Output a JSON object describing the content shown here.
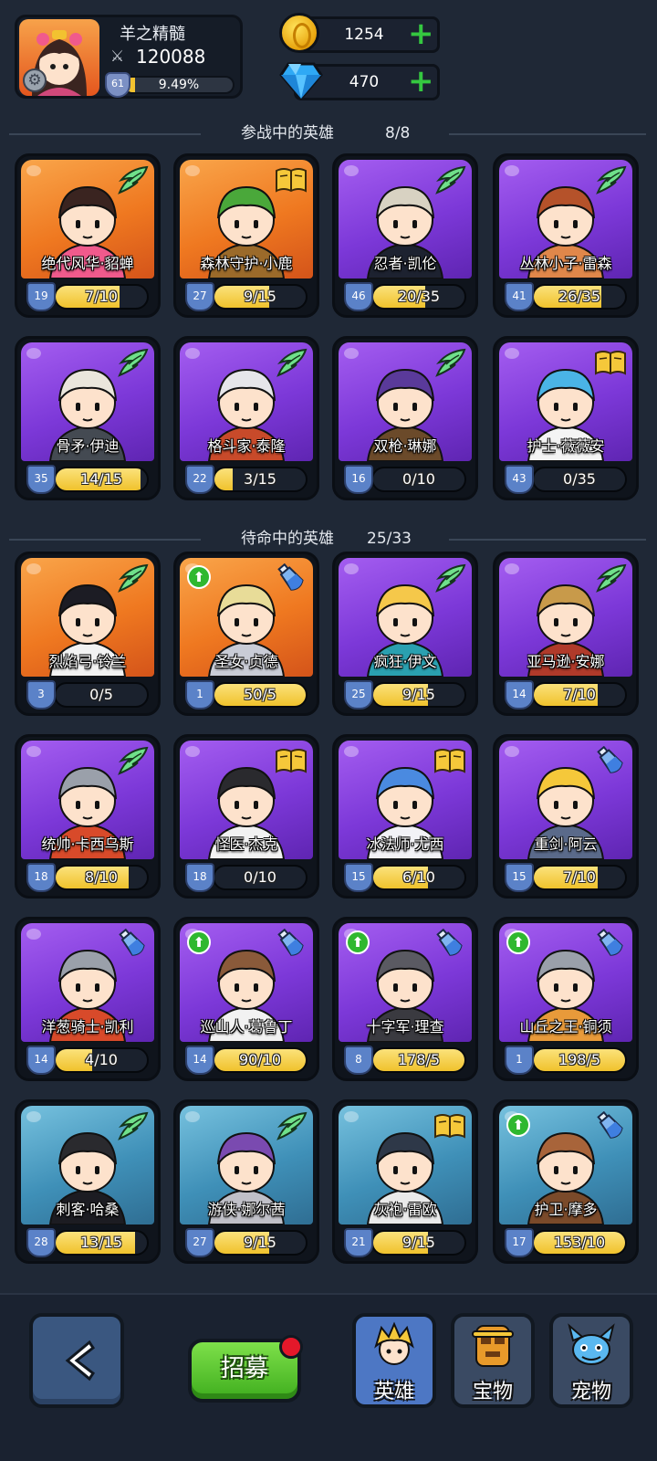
{
  "player": {
    "name": "羊之精髓",
    "power": "120088",
    "level": "61",
    "exp_percent": "9.49%",
    "exp_fraction": 0.0949
  },
  "currency": {
    "gold": "1254",
    "gems": "470"
  },
  "active_section": {
    "title": "参战中的英雄",
    "count": "8/8"
  },
  "reserve_section": {
    "title": "待命中的英雄",
    "count": "25/33"
  },
  "active_heroes": [
    {
      "name": "绝代风华·貂蝉",
      "level": "19",
      "fragments": "7/10",
      "progress": 0.7,
      "bg": "orange",
      "badge": "wing-icon",
      "upgrade": false,
      "hair": "#3a2420",
      "accent": "#f05a8c"
    },
    {
      "name": "森林守护·小鹿",
      "level": "27",
      "fragments": "9/15",
      "progress": 0.6,
      "bg": "orange",
      "badge": "book-icon",
      "upgrade": false,
      "hair": "#4aa83a",
      "accent": "#9b6a2a"
    },
    {
      "name": "忍者·凯伦",
      "level": "46",
      "fragments": "20/35",
      "progress": 0.571,
      "bg": "purple",
      "badge": "wing-icon",
      "upgrade": false,
      "hair": "#d8d2c2",
      "accent": "#1d2230"
    },
    {
      "name": "丛林小子·雷森",
      "level": "41",
      "fragments": "26/35",
      "progress": 0.743,
      "bg": "purple",
      "badge": "wing-icon",
      "upgrade": false,
      "hair": "#b5522a",
      "accent": "#e0874a"
    },
    {
      "name": "骨矛·伊迪",
      "level": "35",
      "fragments": "14/15",
      "progress": 0.933,
      "bg": "purple",
      "badge": "wing-icon",
      "upgrade": false,
      "hair": "#eae6dc",
      "accent": "#444a52"
    },
    {
      "name": "格斗家·泰隆",
      "level": "22",
      "fragments": "3/15",
      "progress": 0.2,
      "bg": "purple",
      "badge": "wing-icon",
      "upgrade": false,
      "hair": "#e6e6ea",
      "accent": "#c84a2a"
    },
    {
      "name": "双枪·琳娜",
      "level": "16",
      "fragments": "0/10",
      "progress": 0.0,
      "bg": "purple",
      "badge": "wing-icon",
      "upgrade": false,
      "hair": "#5a3a9a",
      "accent": "#6b4a2a"
    },
    {
      "name": "护士·薇薇安",
      "level": "43",
      "fragments": "0/35",
      "progress": 0.0,
      "bg": "purple",
      "badge": "book-icon",
      "upgrade": false,
      "hair": "#4ab4e6",
      "accent": "#f4f4f4"
    }
  ],
  "reserve_heroes": [
    {
      "name": "烈焰弓·铃兰",
      "level": "3",
      "fragments": "0/5",
      "progress": 0.0,
      "bg": "orange",
      "badge": "wing-icon",
      "upgrade": false,
      "hair": "#1c1c24",
      "accent": "#f2f2f2"
    },
    {
      "name": "圣女·贞德",
      "level": "1",
      "fragments": "50/5",
      "progress": 1.0,
      "bg": "orange",
      "badge": "potion-icon",
      "upgrade": true,
      "hair": "#e8dc98",
      "accent": "#c9ccd6"
    },
    {
      "name": "疯狂·伊文",
      "level": "25",
      "fragments": "9/15",
      "progress": 0.6,
      "bg": "purple",
      "badge": "wing-icon",
      "upgrade": false,
      "hair": "#f5c84a",
      "accent": "#2aa0b0"
    },
    {
      "name": "亚马逊·安娜",
      "level": "14",
      "fragments": "7/10",
      "progress": 0.7,
      "bg": "purple",
      "badge": "wing-icon",
      "upgrade": false,
      "hair": "#c89a4a",
      "accent": "#b03a2a"
    },
    {
      "name": "统帅·卡西乌斯",
      "level": "18",
      "fragments": "8/10",
      "progress": 0.8,
      "bg": "purple",
      "badge": "wing-icon",
      "upgrade": false,
      "hair": "#9aa0aa",
      "accent": "#d84a2a"
    },
    {
      "name": "怪医·杰克",
      "level": "18",
      "fragments": "0/10",
      "progress": 0.0,
      "bg": "purple",
      "badge": "book-icon",
      "upgrade": false,
      "hair": "#2a2a2e",
      "accent": "#f2f2f2"
    },
    {
      "name": "冰法师·尤西",
      "level": "15",
      "fragments": "6/10",
      "progress": 0.6,
      "bg": "purple",
      "badge": "book-icon",
      "upgrade": false,
      "hair": "#4a8ae0",
      "accent": "#f2f2f6"
    },
    {
      "name": "重剑·阿云",
      "level": "15",
      "fragments": "7/10",
      "progress": 0.7,
      "bg": "purple",
      "badge": "potion-icon",
      "upgrade": false,
      "hair": "#f5c83a",
      "accent": "#5a6a8a"
    },
    {
      "name": "洋葱骑士·凯利",
      "level": "14",
      "fragments": "4/10",
      "progress": 0.4,
      "bg": "purple",
      "badge": "potion-icon",
      "upgrade": false,
      "hair": "#9aa0aa",
      "accent": "#d84a2a"
    },
    {
      "name": "巡山人·葛鲁丁",
      "level": "14",
      "fragments": "90/10",
      "progress": 1.0,
      "bg": "purple",
      "badge": "potion-icon",
      "upgrade": true,
      "hair": "#8a5a3a",
      "accent": "#f2f2f2"
    },
    {
      "name": "十字军·理查",
      "level": "8",
      "fragments": "178/5",
      "progress": 1.0,
      "bg": "purple",
      "badge": "potion-icon",
      "upgrade": true,
      "hair": "#5a5a62",
      "accent": "#3a3a40"
    },
    {
      "name": "山丘之王·铜须",
      "level": "1",
      "fragments": "198/5",
      "progress": 1.0,
      "bg": "purple",
      "badge": "potion-icon",
      "upgrade": true,
      "hair": "#9aa0aa",
      "accent": "#e89a3a"
    },
    {
      "name": "刺客·哈桑",
      "level": "28",
      "fragments": "13/15",
      "progress": 0.867,
      "bg": "blue",
      "badge": "wing-icon",
      "upgrade": false,
      "hair": "#2a2a2e",
      "accent": "#1c1c22"
    },
    {
      "name": "游侠·娜尔茜",
      "level": "27",
      "fragments": "9/15",
      "progress": 0.6,
      "bg": "blue",
      "badge": "wing-icon",
      "upgrade": false,
      "hair": "#7a4ab0",
      "accent": "#c0c0c8"
    },
    {
      "name": "灰袍·雷欧",
      "level": "21",
      "fragments": "9/15",
      "progress": 0.6,
      "bg": "blue",
      "badge": "book-icon",
      "upgrade": false,
      "hair": "#2e3848",
      "accent": "#eaeaea"
    },
    {
      "name": "护卫·摩多",
      "level": "17",
      "fragments": "153/10",
      "progress": 1.0,
      "bg": "blue",
      "badge": "potion-icon",
      "upgrade": true,
      "hair": "#a8643a",
      "accent": "#7a4a2a"
    }
  ],
  "nav": {
    "recruit": "招募",
    "heroes": "英雄",
    "treasures": "宝物",
    "pets": "宠物"
  }
}
